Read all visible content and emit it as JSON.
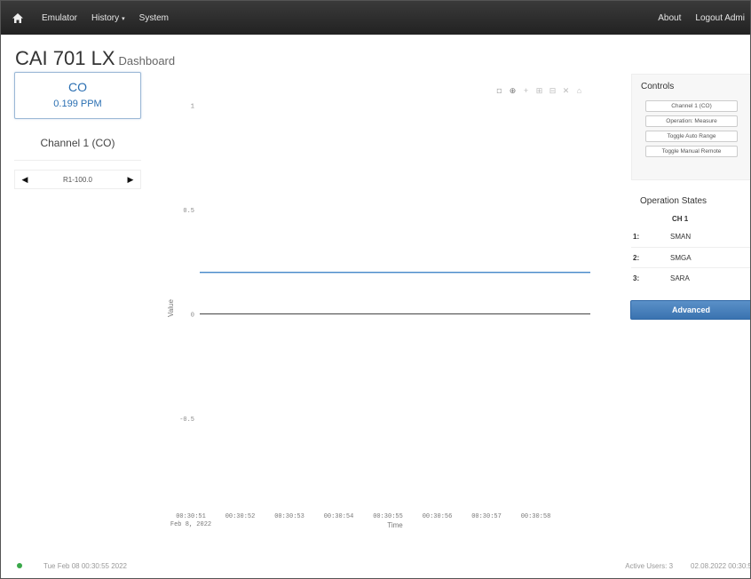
{
  "navbar": {
    "home_icon": "home-icon",
    "items": [
      {
        "label": "Emulator"
      },
      {
        "label": "History"
      },
      {
        "label": "System"
      }
    ],
    "history_caret": "▾",
    "right_items": [
      {
        "label": "About"
      },
      {
        "label": "Logout Admi"
      }
    ]
  },
  "page": {
    "title": "CAI 701 LX",
    "subtitle": "Dashboard"
  },
  "gas_box": {
    "gas": "CO",
    "value": "0.199 PPM"
  },
  "channel": {
    "label": "Channel 1 (CO)",
    "range": "R1-100.0",
    "prev_icon": "◀",
    "next_icon": "▶"
  },
  "controls": {
    "title": "Controls",
    "buttons": [
      {
        "label": "Channel 1 (CO)"
      },
      {
        "label": "Operation: Measure"
      },
      {
        "label": "Toggle Auto Range"
      },
      {
        "label": "Toggle Manual Remote"
      }
    ]
  },
  "operation_states": {
    "title": "Operation States",
    "column": "CH 1",
    "rows": [
      {
        "num": "1:",
        "value": "SMAN"
      },
      {
        "num": "2:",
        "value": "SMGA"
      },
      {
        "num": "3:",
        "value": "SARA"
      }
    ]
  },
  "advanced_button": "Advanced",
  "chart_data": {
    "type": "line",
    "xlabel": "Time",
    "ylabel": "Value",
    "ylim": [
      -0.9,
      1.1
    ],
    "y_ticks": [
      "1",
      "0.5",
      "0",
      "-0.5"
    ],
    "y_tick_values": [
      1,
      0.5,
      0,
      -0.5
    ],
    "x_ticks": [
      "00:30:51",
      "00:30:52",
      "00:30:53",
      "00:30:54",
      "00:30:55",
      "00:30:56",
      "00:30:57",
      "00:30:58"
    ],
    "x_date": "Feb 8, 2022",
    "series": [
      {
        "values": [
          0.199,
          0.199,
          0.199,
          0.199,
          0.199,
          0.199,
          0.199,
          0.199,
          0.199
        ],
        "color": "#2e78c2"
      }
    ],
    "zero_line": true,
    "grid": false
  },
  "modebar_icons": [
    "camera-icon",
    "zoom-icon",
    "pan-icon",
    "zoom-in-icon",
    "zoom-out-icon",
    "autoscale-icon",
    "reset-icon"
  ],
  "footer": {
    "status_color": "#3aa84a",
    "timestamp": "Tue Feb 08 00:30:55 2022",
    "active_users": "Active Users: 3",
    "right_timestamp": "02.08.2022 00:30:5"
  }
}
